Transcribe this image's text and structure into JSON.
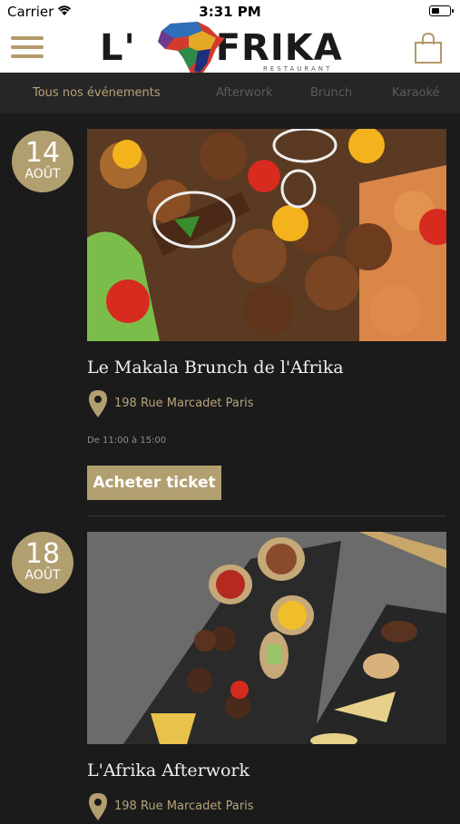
{
  "status_bar": {
    "carrier": "Carrier",
    "time": "3:31 PM"
  },
  "header": {
    "logo_text_left": "L'",
    "logo_text_right": "FRIKA",
    "logo_subtitle": "RESTAURANT"
  },
  "tabs": [
    {
      "label": "Tous nos événements",
      "active": true
    },
    {
      "label": "Afterwork",
      "active": false
    },
    {
      "label": "Brunch",
      "active": false
    },
    {
      "label": "Karaoké",
      "active": false
    }
  ],
  "events": [
    {
      "day": "14",
      "month": "AOÛT",
      "title": "Le Makala Brunch de l'Afrika",
      "address": "198 Rue Marcadet Paris",
      "hours": "De 11:00 à 15:00",
      "button_label": "Acheter ticket"
    },
    {
      "day": "18",
      "month": "AOÛT",
      "title": "L'Afrika Afterwork",
      "address": "198 Rue Marcadet Paris"
    }
  ],
  "colors": {
    "accent": "#b29f70",
    "background": "#1b1b1b",
    "tab_bar": "#262626"
  }
}
